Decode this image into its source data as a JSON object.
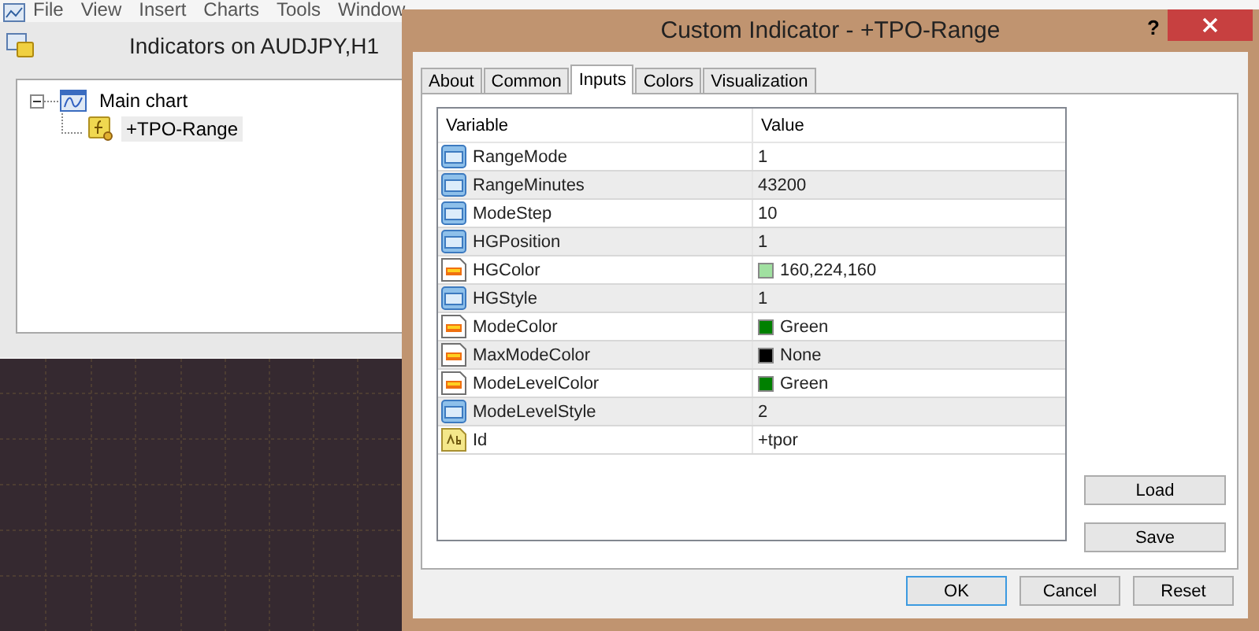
{
  "menu_bar": {
    "items": [
      "File",
      "View",
      "Insert",
      "Charts",
      "Tools",
      "Window"
    ]
  },
  "indicators_window": {
    "title": "Indicators on AUDJPY,H1",
    "tree": [
      {
        "label": "Main chart",
        "expanded": true,
        "children": [
          {
            "label": "+TPO-Range",
            "selected": true
          }
        ]
      }
    ]
  },
  "dialog": {
    "title": "Custom Indicator - +TPO-Range",
    "help": "?",
    "tabs": [
      {
        "label": "About",
        "selected": false
      },
      {
        "label": "Common",
        "selected": false
      },
      {
        "label": "Inputs",
        "selected": true
      },
      {
        "label": "Colors",
        "selected": false
      },
      {
        "label": "Visualization",
        "selected": false
      }
    ],
    "table": {
      "columns": [
        "Variable",
        "Value"
      ],
      "rows": [
        {
          "kind": "number",
          "variable": "RangeMode",
          "value": "1"
        },
        {
          "kind": "number",
          "variable": "RangeMinutes",
          "value": "43200"
        },
        {
          "kind": "number",
          "variable": "ModeStep",
          "value": "10"
        },
        {
          "kind": "number",
          "variable": "HGPosition",
          "value": "1"
        },
        {
          "kind": "color",
          "variable": "HGColor",
          "value": "160,224,160",
          "color": "#a0e0a0"
        },
        {
          "kind": "number",
          "variable": "HGStyle",
          "value": "1"
        },
        {
          "kind": "color",
          "variable": "ModeColor",
          "value": "Green",
          "color": "#008000"
        },
        {
          "kind": "color",
          "variable": "MaxModeColor",
          "value": "None",
          "color": "#000000"
        },
        {
          "kind": "color",
          "variable": "ModeLevelColor",
          "value": "Green",
          "color": "#008000"
        },
        {
          "kind": "number",
          "variable": "ModeLevelStyle",
          "value": "2"
        },
        {
          "kind": "string",
          "variable": "Id",
          "value": "+tpor"
        }
      ]
    },
    "side_buttons": [
      "Load",
      "Save"
    ],
    "buttons": [
      {
        "label": "OK",
        "default": true
      },
      {
        "label": "Cancel",
        "default": false
      },
      {
        "label": "Reset",
        "default": false
      }
    ]
  }
}
